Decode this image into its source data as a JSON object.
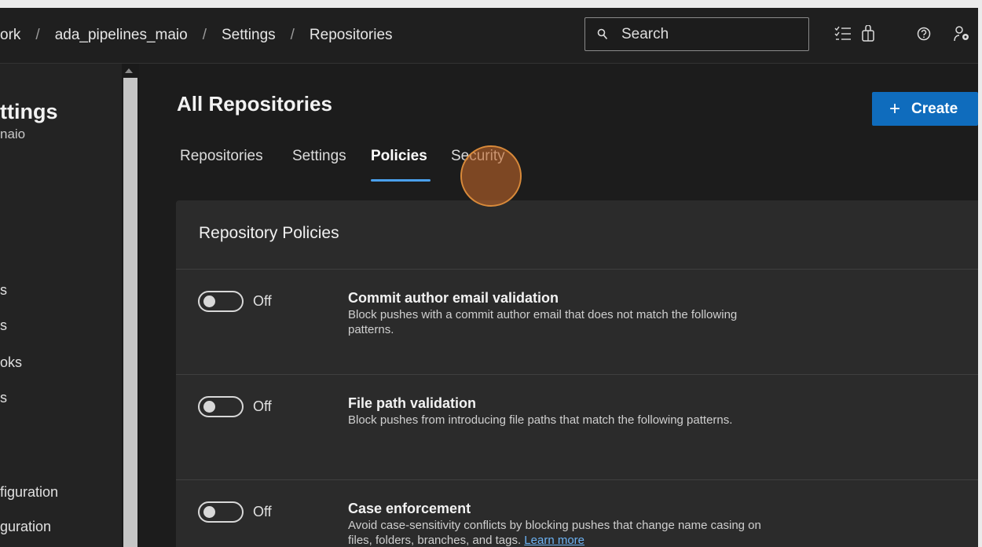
{
  "breadcrumb": {
    "items": [
      "ork",
      "ada_pipelines_maio",
      "Settings",
      "Repositories"
    ],
    "separator": "/"
  },
  "search": {
    "placeholder": "Search"
  },
  "header_icons": [
    "task-list-icon",
    "bag-icon",
    "help-icon",
    "user-settings-icon"
  ],
  "sidebar": {
    "title": "ttings",
    "subtitle": "naio",
    "items": [
      "s",
      "s",
      "oks",
      "s",
      "figuration",
      "guration"
    ]
  },
  "main": {
    "title": "All Repositories",
    "create_label": "Create",
    "tabs": [
      {
        "label": "Repositories",
        "active": false
      },
      {
        "label": "Settings",
        "active": false
      },
      {
        "label": "Policies",
        "active": true
      },
      {
        "label": "Security",
        "active": false
      }
    ]
  },
  "policies": {
    "title": "Repository Policies",
    "items": [
      {
        "state": "Off",
        "title": "Commit author email validation",
        "description": "Block pushes with a commit author email that does not match the following patterns."
      },
      {
        "state": "Off",
        "title": "File path validation",
        "description": "Block pushes from introducing file paths that match the following patterns."
      },
      {
        "state": "Off",
        "title": "Case enforcement",
        "description": "Avoid case-sensitivity conflicts by blocking pushes that change name casing on files, folders, branches, and tags.",
        "link": "Learn more"
      }
    ]
  },
  "colors": {
    "accent": "#0f6cbd",
    "tab_underline": "#4aa0ec",
    "click_indicator": "#d98a3a",
    "background": "#1c1c1c",
    "card": "#2b2b2b"
  }
}
